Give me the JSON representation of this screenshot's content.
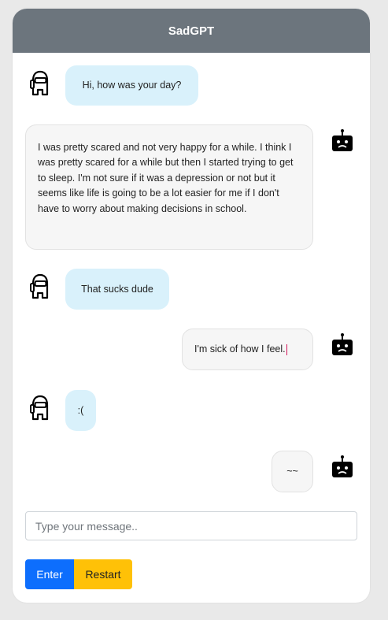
{
  "header": {
    "title": "SadGPT"
  },
  "messages": [
    {
      "sender": "user",
      "text": "Hi, how was your day?"
    },
    {
      "sender": "bot",
      "text": "I was pretty scared and not very happy for a while. I think I was pretty scared for a while but then I started trying to get to sleep. I'm not sure if it was a depression or not but it seems like life is going to be a lot easier for me if I don't have to worry about making decisions in school."
    },
    {
      "sender": "user",
      "text": "That sucks dude"
    },
    {
      "sender": "bot",
      "text": "I'm sick of how I feel."
    },
    {
      "sender": "user",
      "text": ":("
    },
    {
      "sender": "bot",
      "text": "~~"
    }
  ],
  "composer": {
    "placeholder": "Type your message..",
    "value": ""
  },
  "buttons": {
    "enter_label": "Enter",
    "restart_label": "Restart"
  },
  "icons": {
    "user_avatar": "crewmate-outline-icon",
    "bot_avatar": "sad-robot-icon"
  },
  "colors": {
    "header_bg": "#6c757d",
    "user_bubble": "#d9f1fb",
    "bot_bubble": "#f6f6f6",
    "enter_button": "#0d6efd",
    "restart_button": "#ffc107"
  }
}
